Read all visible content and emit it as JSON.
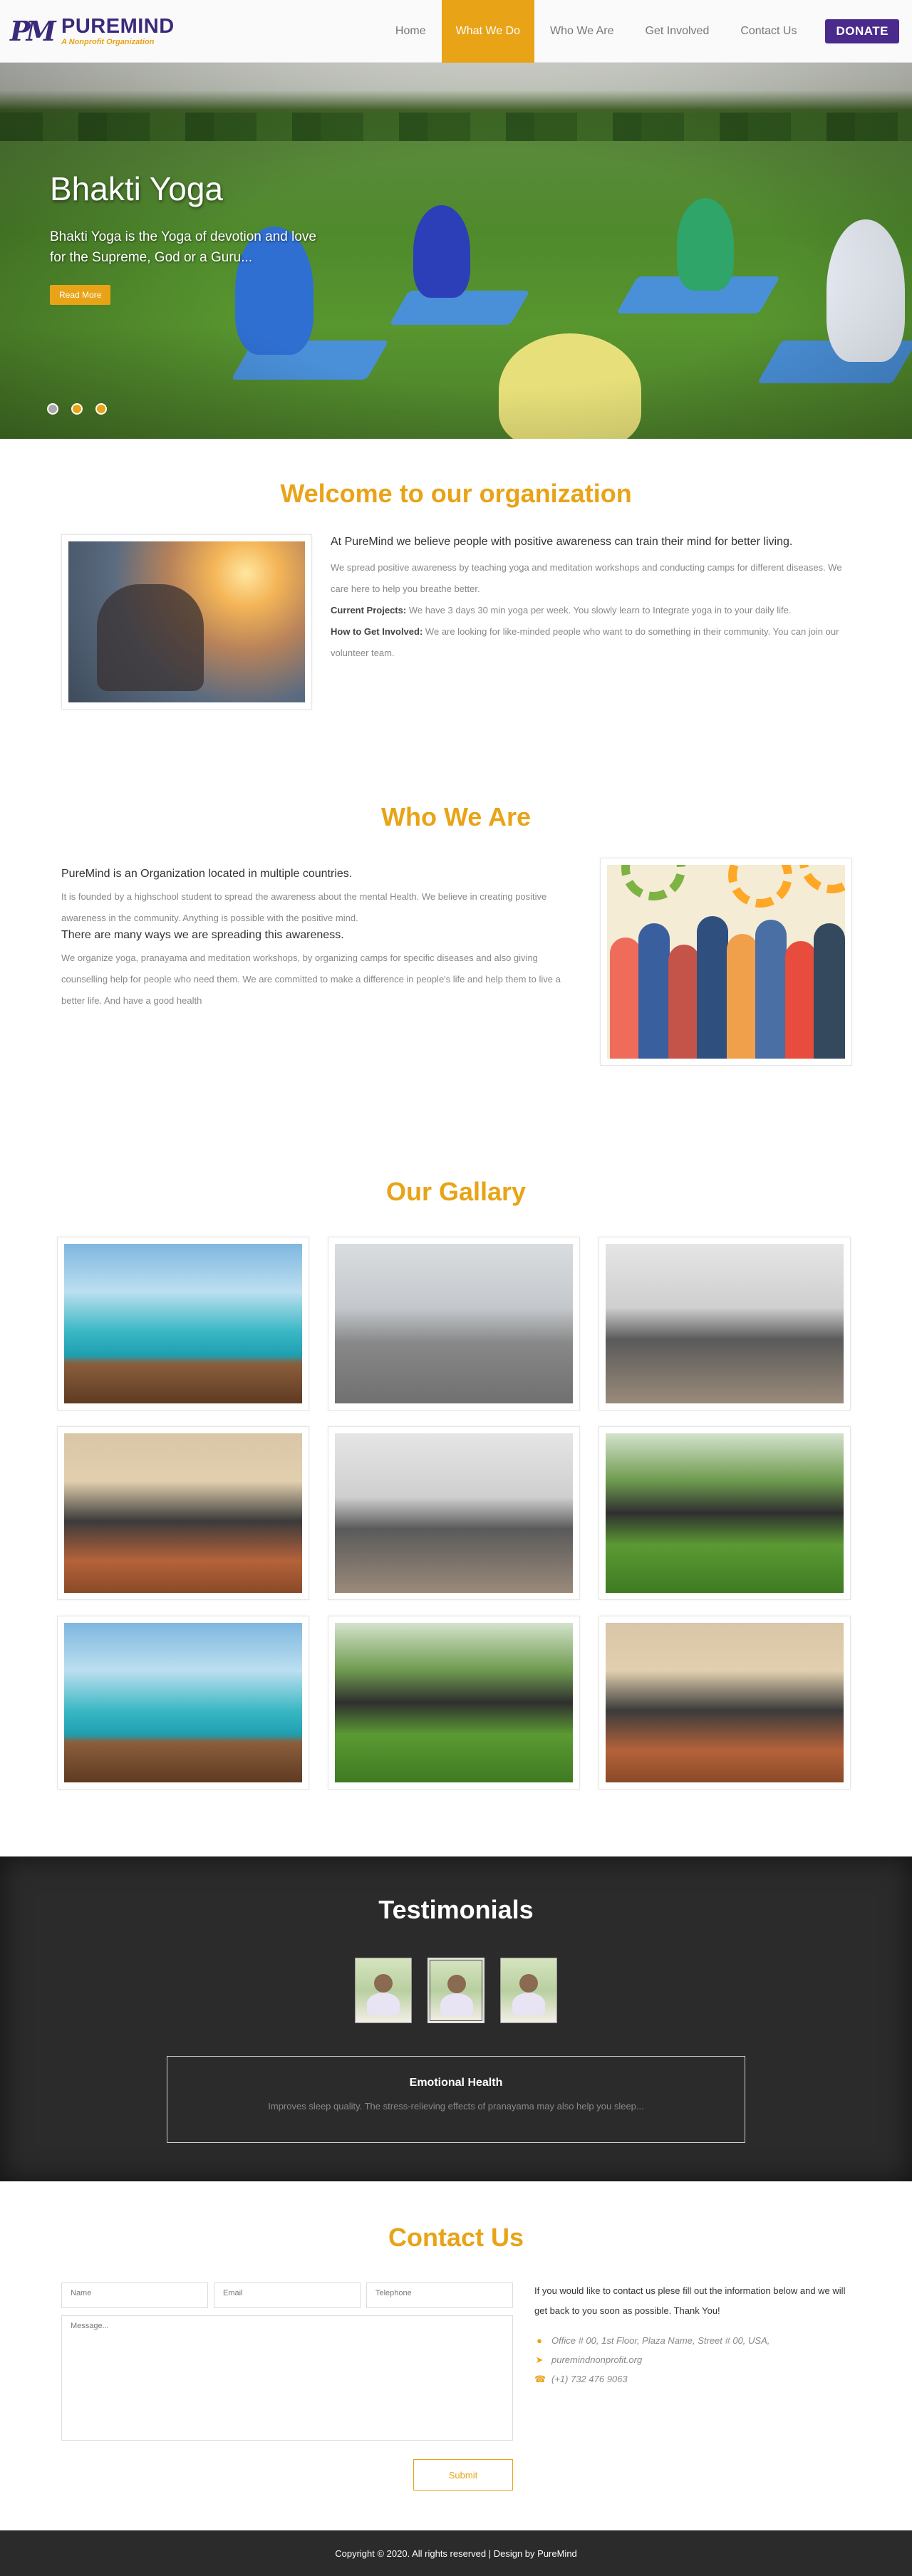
{
  "header": {
    "logo_mark": "PM",
    "brand": "PUREMIND",
    "tagline": "A Nonprofit Organization",
    "nav": [
      "Home",
      "What We Do",
      "Who We Are",
      "Get Involved",
      "Contact Us"
    ],
    "active_nav": "What We Do",
    "donate_label": "DONATE"
  },
  "hero": {
    "title": "Bhakti Yoga",
    "subtitle": "Bhakti Yoga is the Yoga of devotion and love for the Supreme, God or a Guru...",
    "button_label": "Read More",
    "slide_count": 3,
    "active_slide": 1
  },
  "welcome": {
    "title": "Welcome to our organization",
    "lead": "At PureMind we believe people with positive awareness can train their mind for better living.",
    "body": "We spread positive awareness by teaching yoga and meditation workshops and conducting camps for different diseases. We care here to help you breathe better.",
    "projects_label": "Current Projects:",
    "projects_text": " We have 3 days 30 min yoga per week. You slowly learn to Integrate yoga in to your daily life.",
    "involve_label": "How to Get Involved:",
    "involve_text": " We are looking for like-minded people who want to do something in their community. You can join our volunteer team."
  },
  "who": {
    "title": "Who We Are",
    "lead1": "PureMind is an Organization located in multiple countries.",
    "body1": "It is founded by a highschool student to spread the awareness about the mental Health. We believe in creating positive awareness in the community. Anything is possible with the positive mind.",
    "lead2": "There are many ways we are spreading this awareness.",
    "body2": "We organize yoga, pranayama and meditation workshops, by organizing camps for specific diseases and also giving counselling help for people who need them. We are committed to make a difference in people's life and help them to live a better life. And have a good health"
  },
  "gallery": {
    "title": "Our Gallary"
  },
  "testimonials": {
    "title": "Testimonials",
    "active_index": 1,
    "heading": "Emotional Health",
    "quote": "Improves sleep quality. The stress-relieving effects of pranayama may also help you sleep..."
  },
  "contact": {
    "title": "Contact Us",
    "name_placeholder": "Name",
    "email_placeholder": "Email",
    "phone_placeholder": "Telephone",
    "message_placeholder": "Message...",
    "submit_label": "Submit",
    "intro": "If you would like to contact us plese fill out the information below and we will get back to you soon as possible. Thank You!",
    "address": "Office # 00, 1st Floor, Plaza Name, Street # 00, USA,",
    "website": "puremindnonprofit.org",
    "phone": "(+1) 732 476 9063"
  },
  "footer": {
    "text": "Copyright © 2020. All rights reserved | Design by PureMind"
  },
  "colors": {
    "accent": "#e8a317",
    "brand": "#4a2a8c",
    "dark": "#2b2b2b"
  }
}
